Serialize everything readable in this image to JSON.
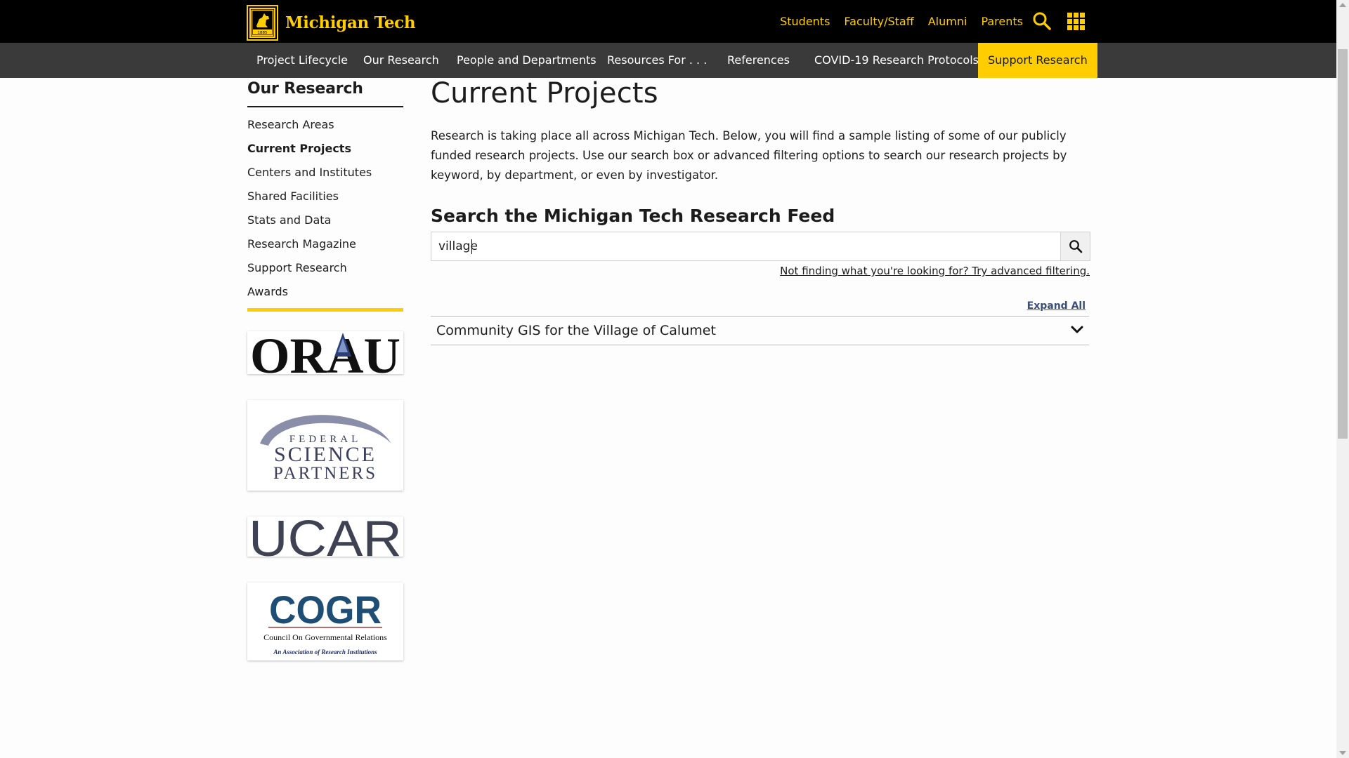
{
  "header": {
    "logo_text": "Michigan Tech",
    "logo_year": "1885",
    "top_links": [
      "Students",
      "Faculty/Staff",
      "Alumni",
      "Parents"
    ],
    "search_icon": "search-icon",
    "menu_icon": "apps-grid-icon"
  },
  "nav": {
    "items": [
      "Project Lifecycle",
      "Our Research",
      "People and Departments",
      "Resources For . . .",
      "References",
      "COVID-19 Research Protocols"
    ],
    "support_label": "Support Research"
  },
  "sidebar": {
    "title": "Our Research",
    "items": [
      "Research Areas",
      "Current Projects",
      "Centers and Institutes",
      "Shared Facilities",
      "Stats and Data",
      "Research Magazine",
      "Support Research",
      "Awards"
    ],
    "active_item": "Current Projects"
  },
  "partners": {
    "orau": "ORAU",
    "fsp_line1": "FEDERAL",
    "fsp_line2": "SCIENCE",
    "fsp_line3": "PARTNERS",
    "ucar": "UCAR",
    "cogr": "COGR",
    "cogr_sub": "Council On Governmental Relations",
    "cogr_tag": "An Association of Research Institutions"
  },
  "main": {
    "title": "Current Projects",
    "intro": "Research is taking place all across Michigan Tech. Below, you will find a sample listing of some of our publicly funded research projects. Use our search box or advanced filtering options to search our research projects by keyword, by department, or even by investigator.",
    "search_heading": "Search the Michigan Tech Research Feed",
    "search_value": "village",
    "advanced_link": "Not finding what you're looking for? Try advanced filtering.",
    "expand_all": "Expand All",
    "results": [
      {
        "title": "Community GIS for the Village of Calumet"
      }
    ]
  },
  "colors": {
    "gold": "#ffcd00",
    "black": "#000000",
    "nav_gray": "#3a3a3a"
  }
}
